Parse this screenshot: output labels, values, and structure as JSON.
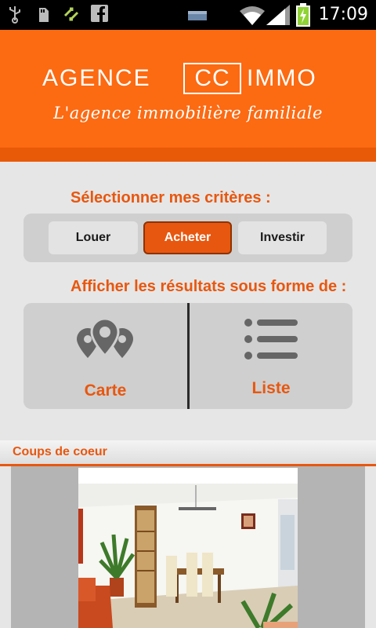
{
  "status_bar": {
    "time": "17:09",
    "icons": [
      "usb-icon",
      "sd-card-icon",
      "sync-arrows-icon",
      "facebook-icon",
      "battery-small-icon",
      "wifi-icon",
      "signal-icon",
      "battery-charging-icon"
    ]
  },
  "header": {
    "logo_left": "AGENCE",
    "logo_box": "CC",
    "logo_right": "IMMO",
    "tagline": "L'agence immobilière familiale",
    "colors": {
      "orange": "#fc6a12",
      "band": "#e85a08"
    }
  },
  "criteria": {
    "title": "Sélectionner mes critères :",
    "options": [
      {
        "label": "Louer",
        "selected": false
      },
      {
        "label": "Acheter",
        "selected": true
      },
      {
        "label": "Investir",
        "selected": false
      }
    ]
  },
  "display": {
    "title": "Afficher les résultats sous forme de :",
    "map_label": "Carte",
    "map_icon": "map-pins-icon",
    "list_label": "Liste",
    "list_icon": "list-icon"
  },
  "favorites": {
    "title": "Coups de coeur",
    "photo": "property-photo"
  },
  "accent_color": "#e8570f"
}
